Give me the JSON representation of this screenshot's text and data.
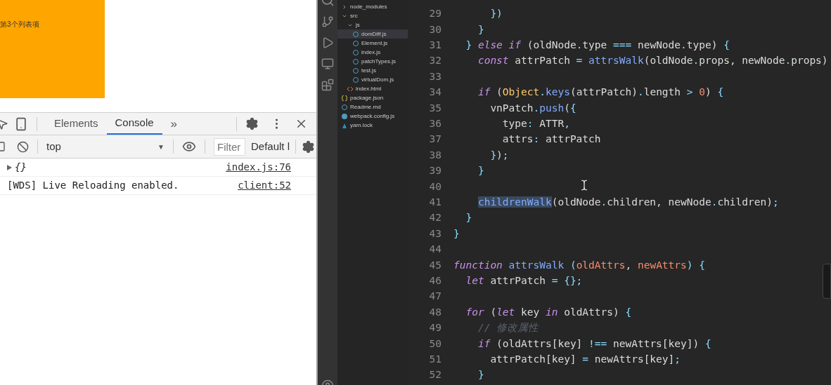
{
  "page": {
    "list_items": [
      "第3个列表项"
    ]
  },
  "devtools": {
    "tabs": [
      {
        "label": "Elements",
        "selected": false
      },
      {
        "label": "Console",
        "selected": true
      }
    ],
    "more": "»",
    "context": "top",
    "context_caret": "▼",
    "filter": {
      "placeholder": "Filter"
    },
    "levels": "Default l",
    "messages": [
      {
        "kind": "object",
        "text": "{}",
        "source": "index.js:76"
      },
      {
        "kind": "log",
        "text": "[WDS] Live Reloading enabled.",
        "source": "client:52"
      }
    ]
  },
  "explorer": [
    {
      "name": "node_modules",
      "kind": "folder",
      "expanded": false,
      "selected": false
    },
    {
      "name": "src",
      "kind": "folder",
      "expanded": true,
      "selected": false,
      "children": [
        {
          "name": "js",
          "kind": "folder",
          "expanded": true,
          "selected": false,
          "children": [
            {
              "name": "domDiff.js",
              "kind": "js",
              "selected": true
            },
            {
              "name": "Element.js",
              "kind": "js",
              "selected": false
            },
            {
              "name": "index.js",
              "kind": "js",
              "selected": false
            },
            {
              "name": "patchTypes.js",
              "kind": "js",
              "selected": false
            },
            {
              "name": "test.js",
              "kind": "js",
              "selected": false
            },
            {
              "name": "virtualDom.js",
              "kind": "js",
              "selected": false
            }
          ]
        },
        {
          "name": "index.html",
          "kind": "html",
          "selected": false
        }
      ]
    },
    {
      "name": "package.json",
      "kind": "json",
      "selected": false
    },
    {
      "name": "Readme.md",
      "kind": "info",
      "selected": false
    },
    {
      "name": "webpack.config.js",
      "kind": "webpack",
      "selected": false
    },
    {
      "name": "yarn.lock",
      "kind": "yarn",
      "selected": false
    }
  ],
  "editor": {
    "lines": [
      {
        "number": "29",
        "tokens": [
          {
            "kind": "punct",
            "text": "      })"
          }
        ]
      },
      {
        "number": "30",
        "tokens": [
          {
            "kind": "punct",
            "text": "    }"
          }
        ]
      },
      {
        "number": "31",
        "tokens": [
          {
            "kind": "punct",
            "text": "  }"
          },
          {
            "kind": "keyword",
            "text": " else if"
          },
          {
            "kind": "plain",
            "text": " (oldNode"
          },
          {
            "kind": "punct",
            "text": "."
          },
          {
            "kind": "plain",
            "text": "type "
          },
          {
            "kind": "punct",
            "text": "==="
          },
          {
            "kind": "plain",
            "text": " newNode"
          },
          {
            "kind": "punct",
            "text": "."
          },
          {
            "kind": "plain",
            "text": "type) "
          },
          {
            "kind": "punct",
            "text": "{"
          }
        ]
      },
      {
        "number": "32",
        "tokens": [
          {
            "kind": "keyword",
            "text": "    const"
          },
          {
            "kind": "plain",
            "text": " attrPatch "
          },
          {
            "kind": "punct",
            "text": "="
          },
          {
            "kind": "func",
            "text": " attrsWalk"
          },
          {
            "kind": "plain",
            "text": "(oldNode"
          },
          {
            "kind": "punct",
            "text": "."
          },
          {
            "kind": "plain",
            "text": "props, newNode"
          },
          {
            "kind": "punct",
            "text": "."
          },
          {
            "kind": "plain",
            "text": "props)"
          }
        ]
      },
      {
        "number": "33"
      },
      {
        "number": "34",
        "tokens": [
          {
            "kind": "keyword",
            "text": "    if"
          },
          {
            "kind": "plain",
            "text": " ("
          },
          {
            "kind": "class",
            "text": "Object"
          },
          {
            "kind": "punct",
            "text": "."
          },
          {
            "kind": "func",
            "text": "keys"
          },
          {
            "kind": "plain",
            "text": "(attrPatch)"
          },
          {
            "kind": "punct",
            "text": "."
          },
          {
            "kind": "plain",
            "text": "length "
          },
          {
            "kind": "punct",
            "text": ">"
          },
          {
            "kind": "number",
            "text": " 0"
          },
          {
            "kind": "plain",
            "text": ") "
          },
          {
            "kind": "punct",
            "text": "{"
          }
        ]
      },
      {
        "number": "35",
        "tokens": [
          {
            "kind": "plain",
            "text": "      vnPatch"
          },
          {
            "kind": "punct",
            "text": "."
          },
          {
            "kind": "func",
            "text": "push"
          },
          {
            "kind": "plain",
            "text": "("
          },
          {
            "kind": "punct",
            "text": "{"
          }
        ]
      },
      {
        "number": "36",
        "tokens": [
          {
            "kind": "plain",
            "text": "        type"
          },
          {
            "kind": "punct",
            "text": ":"
          },
          {
            "kind": "plain",
            "text": " ATTR"
          },
          {
            "kind": "punct",
            "text": ","
          }
        ]
      },
      {
        "number": "37",
        "tokens": [
          {
            "kind": "plain",
            "text": "        attrs"
          },
          {
            "kind": "punct",
            "text": ":"
          },
          {
            "kind": "plain",
            "text": " attrPatch"
          }
        ]
      },
      {
        "number": "38",
        "tokens": [
          {
            "kind": "punct",
            "text": "      }"
          },
          {
            "kind": "plain",
            "text": ")"
          },
          {
            "kind": "punct",
            "text": ";"
          }
        ]
      },
      {
        "number": "39",
        "tokens": [
          {
            "kind": "punct",
            "text": "    }"
          }
        ]
      },
      {
        "number": "40"
      },
      {
        "number": "41",
        "tokens": [
          {
            "kind": "match",
            "text": "    childrenWalk"
          },
          {
            "kind": "plain",
            "text": "(oldNode"
          },
          {
            "kind": "punct",
            "text": "."
          },
          {
            "kind": "plain",
            "text": "children, newNode"
          },
          {
            "kind": "punct",
            "text": "."
          },
          {
            "kind": "plain",
            "text": "children)"
          },
          {
            "kind": "punct",
            "text": ";"
          }
        ]
      },
      {
        "number": "42",
        "tokens": [
          {
            "kind": "punct",
            "text": "  }"
          }
        ]
      },
      {
        "number": "43",
        "tokens": [
          {
            "kind": "punct",
            "text": "}"
          }
        ]
      },
      {
        "number": "44"
      },
      {
        "number": "45",
        "tokens": [
          {
            "kind": "keyword",
            "text": "function"
          },
          {
            "kind": "func",
            "text": " attrsWalk"
          },
          {
            "kind": "punct",
            "text": " ("
          },
          {
            "kind": "param",
            "text": "oldAttrs"
          },
          {
            "kind": "plain",
            "text": ", "
          },
          {
            "kind": "param",
            "text": "newAttrs"
          },
          {
            "kind": "punct",
            "text": ") {"
          }
        ]
      },
      {
        "number": "46",
        "tokens": [
          {
            "kind": "keyword",
            "text": "  let"
          },
          {
            "kind": "plain",
            "text": " attrPatch "
          },
          {
            "kind": "punct",
            "text": "= {};"
          }
        ]
      },
      {
        "number": "47"
      },
      {
        "number": "48",
        "tokens": [
          {
            "kind": "keyword",
            "text": "  for"
          },
          {
            "kind": "plain",
            "text": " ("
          },
          {
            "kind": "keyword",
            "text": "let"
          },
          {
            "kind": "plain",
            "text": " key "
          },
          {
            "kind": "keyword",
            "text": "in"
          },
          {
            "kind": "plain",
            "text": " oldAttrs) "
          },
          {
            "kind": "punct",
            "text": "{"
          }
        ]
      },
      {
        "number": "49",
        "tokens": [
          {
            "kind": "comment",
            "text": "    // 修改属性"
          }
        ]
      },
      {
        "number": "50",
        "tokens": [
          {
            "kind": "keyword",
            "text": "    if"
          },
          {
            "kind": "plain",
            "text": " (oldAttrs[key] "
          },
          {
            "kind": "punct",
            "text": "!=="
          },
          {
            "kind": "plain",
            "text": " newAttrs[key]) "
          },
          {
            "kind": "punct",
            "text": "{"
          }
        ]
      },
      {
        "number": "51",
        "tokens": [
          {
            "kind": "plain",
            "text": "      attrPatch[key] "
          },
          {
            "kind": "punct",
            "text": "="
          },
          {
            "kind": "plain",
            "text": " newAttrs[key]"
          },
          {
            "kind": "punct",
            "text": ";"
          }
        ]
      },
      {
        "number": "52",
        "tokens": [
          {
            "kind": "punct",
            "text": "    }"
          }
        ]
      }
    ]
  }
}
